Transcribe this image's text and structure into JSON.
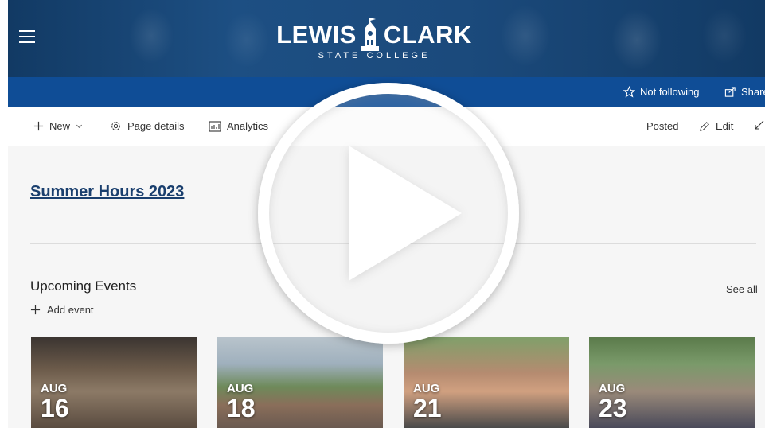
{
  "header": {
    "logo_left": "LEWIS",
    "logo_right": "CLARK",
    "logo_sub": "STATE COLLEGE"
  },
  "bluebar": {
    "follow_label": "Not following",
    "share_label": "Share"
  },
  "toolbar": {
    "new_label": "New",
    "page_details_label": "Page details",
    "analytics_label": "Analytics",
    "posted_label": "Posted",
    "edit_label": "Edit"
  },
  "main": {
    "news_title": "Summer Hours 2023",
    "events_heading": "Upcoming Events",
    "see_all": "See all",
    "add_event": "Add event"
  },
  "events": [
    {
      "month": "AUG",
      "day": "16"
    },
    {
      "month": "AUG",
      "day": "18"
    },
    {
      "month": "AUG",
      "day": "21"
    },
    {
      "month": "AUG",
      "day": "23"
    }
  ],
  "colors": {
    "header_blue": "#1b4a7c",
    "bar_blue": "#0f4d96",
    "link_blue": "#1a3f6e",
    "content_bg": "#f6f6f6"
  },
  "icons": {
    "menu": "hamburger-icon",
    "follow": "star-icon",
    "share": "share-icon",
    "new": "plus-icon",
    "page_details": "gear-icon",
    "analytics": "analytics-icon",
    "edit": "pencil-icon",
    "expand": "expand-icon",
    "add_event": "plus-icon",
    "overlay": "play-icon"
  }
}
